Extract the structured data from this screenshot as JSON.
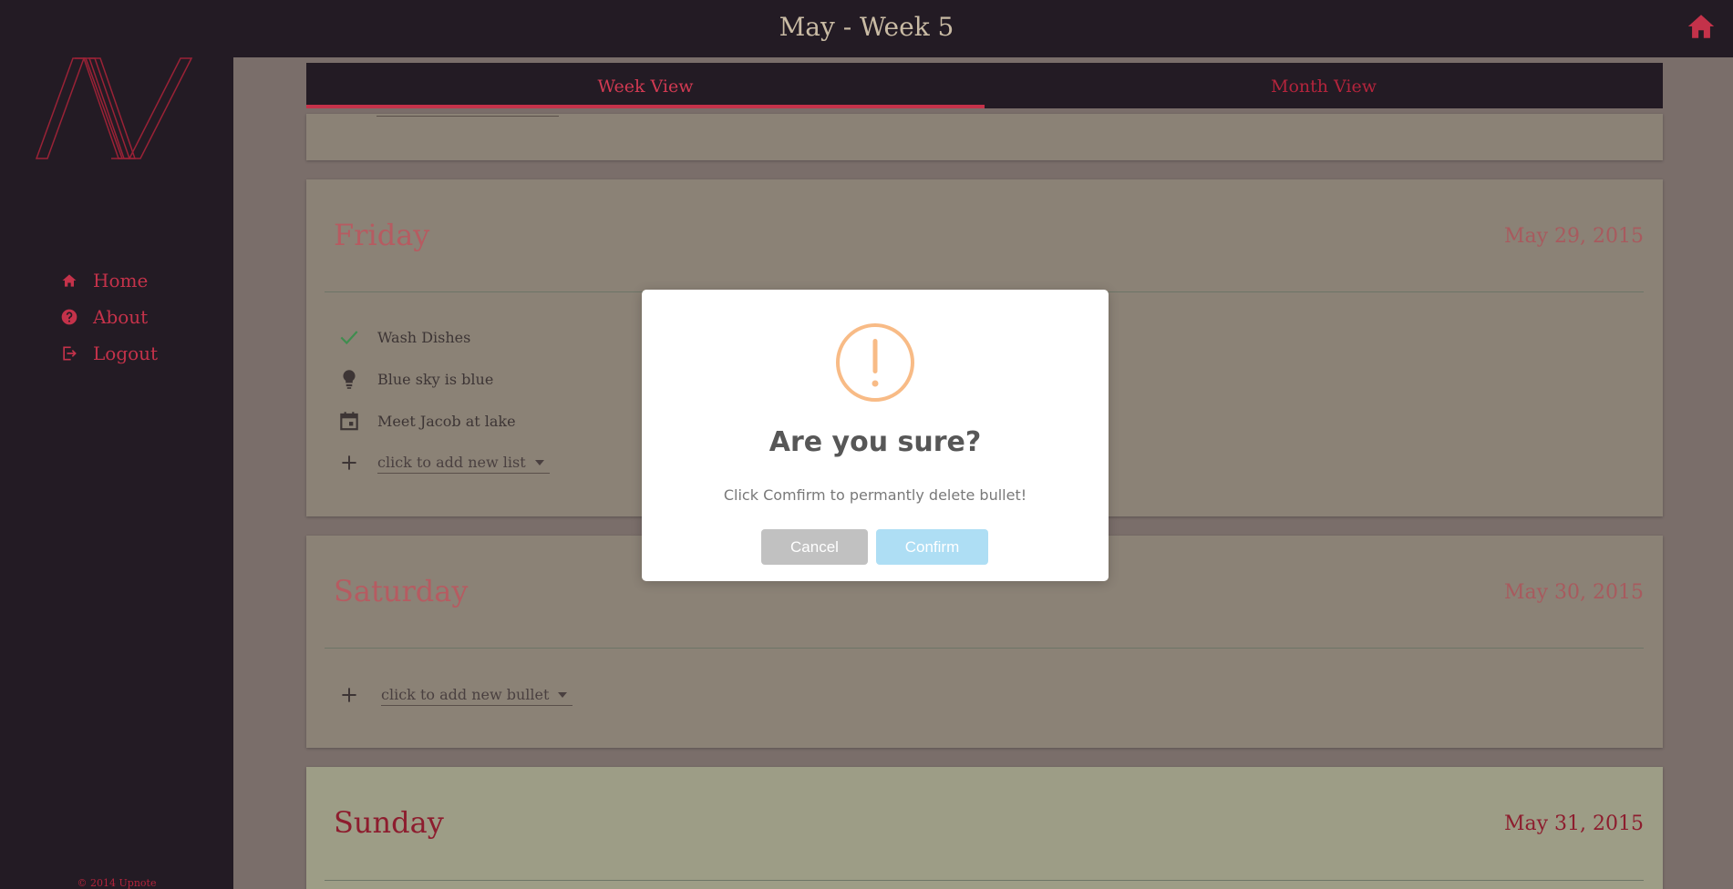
{
  "header": {
    "title": "May - Week 5"
  },
  "sidebar": {
    "items": [
      {
        "label": "Home",
        "icon": "home-icon"
      },
      {
        "label": "About",
        "icon": "help-circle-icon"
      },
      {
        "label": "Logout",
        "icon": "logout-icon"
      }
    ],
    "copyright": "© 2014 Upnote"
  },
  "tabs": [
    {
      "label": "Week View",
      "active": true
    },
    {
      "label": "Month View",
      "active": false
    }
  ],
  "days": {
    "friday": {
      "name": "Friday",
      "date": "May 29, 2015",
      "bullets": [
        {
          "text": "Wash Dishes",
          "icon": "check-icon"
        },
        {
          "text": "Blue sky is blue",
          "icon": "lightbulb-icon"
        },
        {
          "text": "Meet Jacob at lake",
          "icon": "calendar-icon"
        }
      ],
      "adder": "click to add new list"
    },
    "saturday": {
      "name": "Saturday",
      "date": "May 30, 2015",
      "adder": "click to add new bullet"
    },
    "sunday": {
      "name": "Sunday",
      "date": "May 31, 2015"
    }
  },
  "modal": {
    "title": "Are you sure?",
    "message": "Click Comfirm to permantly delete bullet!",
    "cancel_label": "Cancel",
    "confirm_label": "Confirm",
    "icon": "warning-icon"
  },
  "colors": {
    "accent": "#c4324a",
    "chrome": "#231b24",
    "warning": "#f8bb86",
    "confirm": "#aedef4"
  }
}
